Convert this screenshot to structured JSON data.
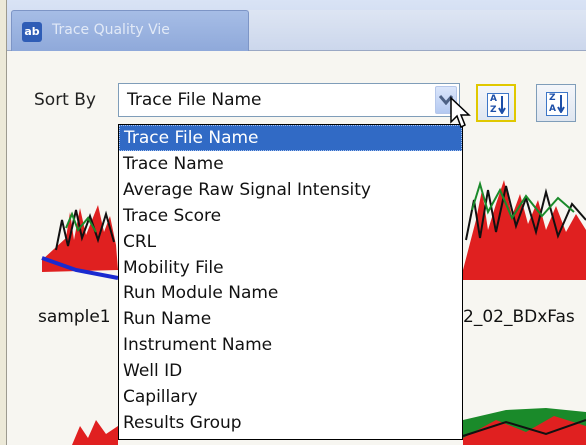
{
  "window": {
    "tab_icon": "ab",
    "tab_title": "Trace Quality Vie"
  },
  "sort": {
    "label": "Sort By",
    "selected": "Trace File Name",
    "options": [
      "Trace File Name",
      "Trace Name",
      "Average Raw Signal Intensity",
      "Trace Score",
      "CRL",
      "Mobility File",
      "Run Module Name",
      "Run Name",
      "Instrument Name",
      "Well ID",
      "Capillary",
      "Results Group"
    ],
    "highlighted_index": 0
  },
  "icons": {
    "dropdown_arrow": "chevron-down-icon",
    "sort_ascending": "sort-ascending-icon",
    "sort_descending": "sort-descending-icon",
    "cursor": "mouse-pointer-icon"
  },
  "plots": {
    "sample_label": "sample1",
    "sample_right_label": "2_02_BDxFas"
  },
  "colors": {
    "selection": "#316ac5",
    "trace_red": "#e02020",
    "trace_green": "#1a8a2a",
    "trace_blue": "#1a2ad0",
    "trace_black": "#111111"
  }
}
